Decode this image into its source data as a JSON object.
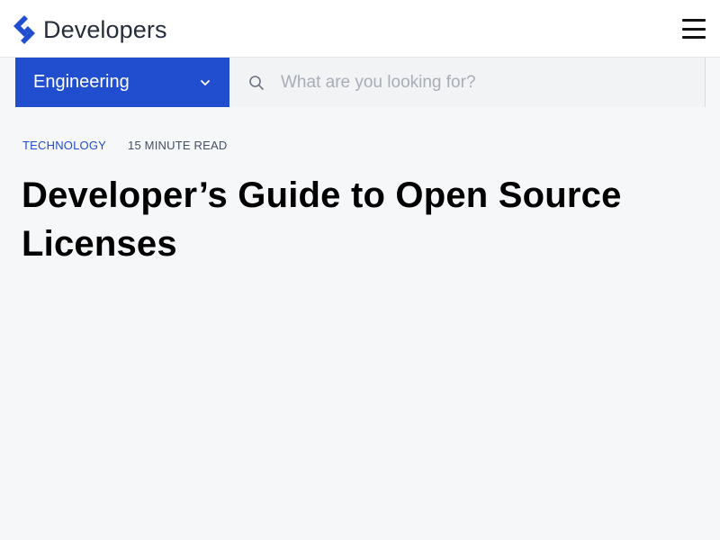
{
  "header": {
    "brand": "Developers",
    "logo_icon": "toptal-logo-icon",
    "menu_icon": "hamburger-menu-icon"
  },
  "subnav": {
    "category_label": "Engineering",
    "category_icon": "chevron-down-icon",
    "search_icon": "search-icon",
    "search_placeholder": "What are you looking for?",
    "search_value": ""
  },
  "article": {
    "tag": "TECHNOLOGY",
    "read_time": "15 MINUTE READ",
    "title": "Developer’s Guide to Open Source Licenses"
  },
  "colors": {
    "brand_blue": "#204ecf",
    "page_bg": "#f6f7f9",
    "header_bg": "#ffffff"
  }
}
